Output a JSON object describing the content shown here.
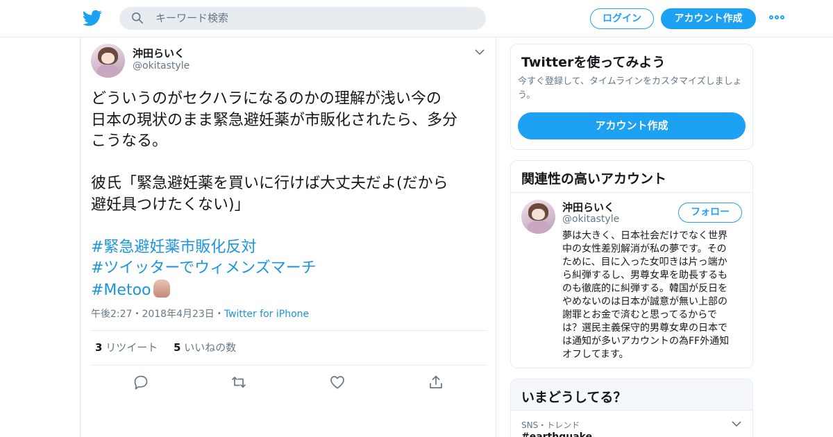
{
  "header": {
    "logo_icon": "twitter-bird-icon",
    "search_placeholder": "キーワード検索",
    "login_label": "ログイン",
    "signup_label": "アカウント作成",
    "more_icon": "more-dots-icon",
    "accent_color": "#1da1f2"
  },
  "tweet": {
    "author_name": "沖田らいく",
    "author_handle": "@okitastyle",
    "paragraph1": [
      "どういうのがセクハラになるのかの理解が浅い今の",
      "日本の現状のまま緊急避妊薬が市販化されたら、多分",
      "こうなる。"
    ],
    "paragraph2": [
      "彼氏「緊急避妊薬を買いに行けば大丈夫だよ(だから",
      "避妊具つけたくない)」"
    ],
    "hashtags": [
      "#緊急避妊薬市販化反対",
      "#ツイッターでウィメンズマーチ",
      "#Metoo"
    ],
    "emoji": "raised-hand-emoji",
    "time": "午後2:27",
    "date": "2018年4月23日",
    "source": "Twitter for iPhone",
    "meta_separator": "・",
    "retweet_count": "3",
    "retweet_label": "リツイート",
    "like_count": "5",
    "like_label": "いいねの数",
    "hashtag_color": "#1b95e0"
  },
  "sidebar": {
    "signup_card": {
      "title": "Twitterを使ってみよう",
      "desc_lines": [
        "今すぐ登録して、タイムラインをカスタマイズしましょ",
        "う。"
      ],
      "button_label": "アカウント作成"
    },
    "related_card": {
      "title": "関連性の高いアカウント",
      "name": "沖田らいく",
      "handle": "@okitastyle",
      "follow_label": "フォロー",
      "bio_lines": [
        "夢は大きく、日本社会だけでなく世界",
        "中の女性差別解消が私の夢です。その",
        "ために、目に入った女叩きは片っ端か",
        "ら糾弾するし、男尊女卑を助長するも",
        "のも徹底的に糾弾する。韓国が反日を",
        "やめないのは日本が誠意が無い上部の",
        "謝罪とお金で済むと思ってるからで",
        "は？選民主義保守的男尊女卑の日本で",
        "は通知が多いアカウントの為FF外通知",
        "オフしてます。"
      ]
    },
    "trends_card": {
      "title": "いまどうしてる？",
      "trend_meta": "SNS・トレンド",
      "trend_name": "#earthquake"
    }
  }
}
